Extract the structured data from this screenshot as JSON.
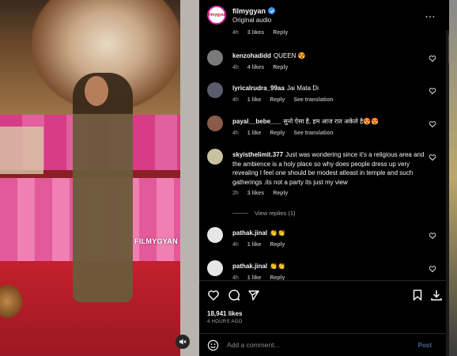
{
  "media": {
    "watermark": "FILMYGYAN"
  },
  "header": {
    "avatar_text": "filmygyan",
    "username": "filmygyan",
    "audio": "Original audio"
  },
  "comments": [
    {
      "partial_meta": {
        "time": "4h",
        "likes": "3 likes",
        "reply": "Reply"
      }
    },
    {
      "username": "kenzohadidd",
      "text": "QUEEN",
      "emoji": "😍",
      "time": "4h",
      "likes": "4 likes",
      "reply": "Reply",
      "avatar_color": "#7a7a7a"
    },
    {
      "username": "lyricalrudra_99aa",
      "text": "Jai Mata Di",
      "time": "4h",
      "likes": "1 like",
      "reply": "Reply",
      "translate": "See translation",
      "avatar_color": "#5b5b6b"
    },
    {
      "username": "payal__bebe___",
      "text": "सुनो ऐसा है, हम आज रात अकेले है",
      "emoji": "😍😍",
      "time": "4h",
      "likes": "1 like",
      "reply": "Reply",
      "translate": "See translation",
      "avatar_color": "#8a5a4a"
    },
    {
      "username": "skyisthelimit.377",
      "text": "Just was wondering since it's a religious area and the ambience is a holy place so why does people dress up very revealing I feel one should be modest atleast in temple and such gatherings .its not a party its just my view",
      "time": "2h",
      "likes": "3 likes",
      "reply": "Reply",
      "avatar_color": "#c9c2a0"
    },
    {
      "username": "pathak.jinal",
      "text": "👏👏",
      "time": "4h",
      "likes": "1 like",
      "reply": "Reply",
      "avatar_color": "#e6e6e6"
    },
    {
      "username": "pathak.jinal",
      "text": "👏👏",
      "time": "4h",
      "likes": "1 like",
      "reply": "Reply",
      "avatar_color": "#e6e6e6"
    }
  ],
  "view_replies": "View replies (1)",
  "likes_count": "18,941 likes",
  "posted_ago": "4 HOURS AGO",
  "add_comment": {
    "placeholder": "Add a comment...",
    "post_label": "Post"
  },
  "colors": {
    "verified": "#3897f0",
    "post_link": "#4a6c8f",
    "muted_text": "#a8a8a8"
  }
}
